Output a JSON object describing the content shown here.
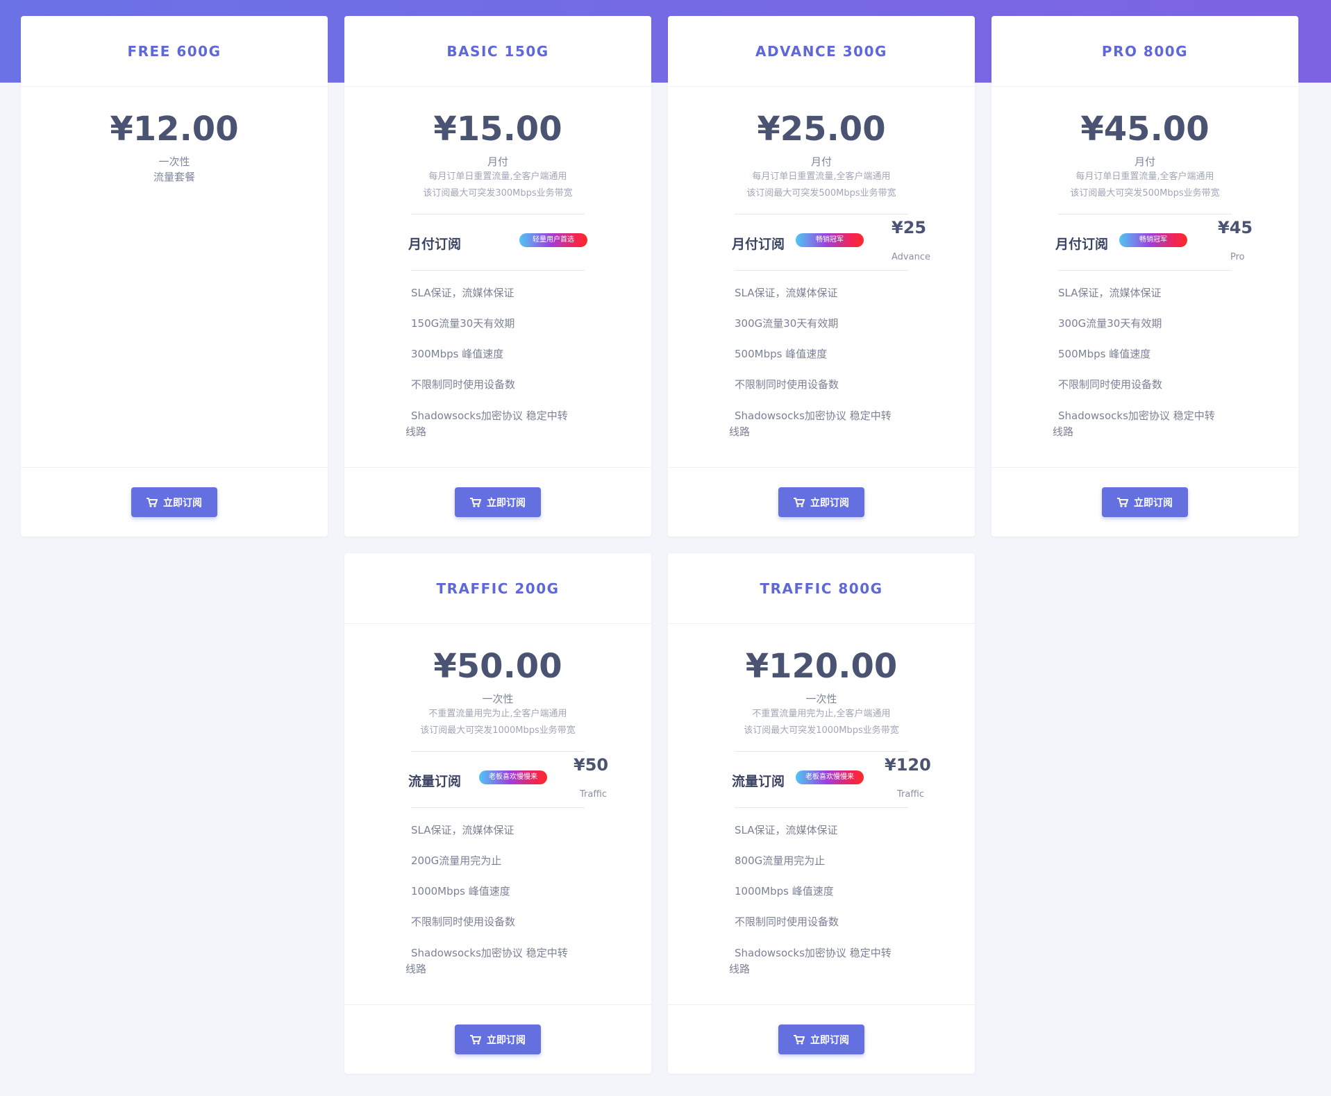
{
  "plans": [
    {
      "name": "FREE 600G",
      "price": "¥12.00",
      "period": "一次性",
      "desc": [
        "流量套餐"
      ],
      "subscription": null,
      "features": [],
      "button": "立即订阅"
    },
    {
      "name": "BASIC 150G",
      "price": "¥15.00",
      "period": "月付",
      "desc": [
        "每月订单日重置流量,全客户端通用",
        "该订阅最大可突发300Mbps业务带宽"
      ],
      "subscription": {
        "title": "月付订阅",
        "badge": "轻量用户首选",
        "alt_price": "",
        "alt_tag": ""
      },
      "features": [
        "SLA保证，流媒体保证",
        "150G流量30天有效期",
        "300Mbps 峰值速度",
        "不限制同时使用设备数",
        "Shadowsocks加密协议 稳定中转",
        "线路"
      ],
      "button": "立即订阅"
    },
    {
      "name": "ADVANCE 300G",
      "price": "¥25.00",
      "period": "月付",
      "desc": [
        "每月订单日重置流量,全客户端通用",
        "该订阅最大可突发500Mbps业务带宽"
      ],
      "subscription": {
        "title": "月付订阅",
        "badge": "畅销冠军",
        "alt_price": "¥25",
        "alt_tag": "Advance"
      },
      "features": [
        "SLA保证，流媒体保证",
        "300G流量30天有效期",
        "500Mbps 峰值速度",
        "不限制同时使用设备数",
        "Shadowsocks加密协议 稳定中转",
        "线路"
      ],
      "button": "立即订阅"
    },
    {
      "name": "PRO 800G",
      "price": "¥45.00",
      "period": "月付",
      "desc": [
        "每月订单日重置流量,全客户端通用",
        "该订阅最大可突发500Mbps业务带宽"
      ],
      "subscription": {
        "title": "月付订阅",
        "badge": "畅销冠军",
        "alt_price": "¥45",
        "alt_tag": "Pro"
      },
      "features": [
        "SLA保证，流媒体保证",
        "300G流量30天有效期",
        "500Mbps 峰值速度",
        "不限制同时使用设备数",
        "Shadowsocks加密协议 稳定中转",
        "线路"
      ],
      "button": "立即订阅"
    },
    {
      "name": "TRAFFIC 200G",
      "price": "¥50.00",
      "period": "一次性",
      "desc": [
        "不重置流量用完为止,全客户端通用",
        "该订阅最大可突发1000Mbps业务带宽"
      ],
      "subscription": {
        "title": "流量订阅",
        "badge": "老板喜欢慢慢来",
        "alt_price": "¥50",
        "alt_tag": "Traffic"
      },
      "features": [
        "SLA保证，流媒体保证",
        "200G流量用完为止",
        "1000Mbps 峰值速度",
        "不限制同时使用设备数",
        "Shadowsocks加密协议 稳定中转",
        "线路"
      ],
      "button": "立即订阅"
    },
    {
      "name": "TRAFFIC 800G",
      "price": "¥120.00",
      "period": "一次性",
      "desc": [
        "不重置流量用完为止,全客户端通用",
        "该订阅最大可突发1000Mbps业务带宽"
      ],
      "subscription": {
        "title": "流量订阅",
        "badge": "老板喜欢慢慢来",
        "alt_price": "¥120",
        "alt_tag": "Traffic"
      },
      "features": [
        "SLA保证，流媒体保证",
        "800G流量用完为止",
        "1000Mbps 峰值速度",
        "不限制同时使用设备数",
        "Shadowsocks加密协议 稳定中转",
        "线路"
      ],
      "button": "立即订阅"
    }
  ],
  "icons": {
    "button_icon": "cart-icon"
  },
  "colors": {
    "accent": "#6470e0",
    "plan_name": "#5f68d9",
    "header_band": "#7069e3"
  }
}
